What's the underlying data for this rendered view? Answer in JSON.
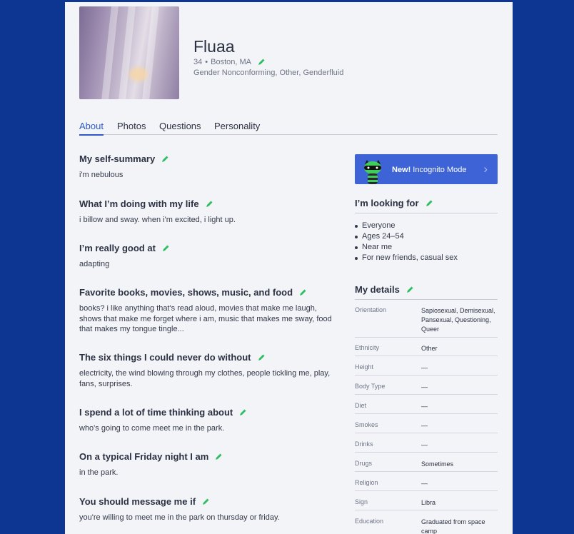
{
  "profile": {
    "name": "Fluaa",
    "age": "34",
    "separator": "•",
    "location": "Boston, MA",
    "identity": "Gender Nonconforming, Other, Genderfluid"
  },
  "tabs": [
    {
      "label": "About",
      "active": true
    },
    {
      "label": "Photos",
      "active": false
    },
    {
      "label": "Questions",
      "active": false
    },
    {
      "label": "Personality",
      "active": false
    }
  ],
  "essays": [
    {
      "title": "My self-summary",
      "text": "i'm nebulous"
    },
    {
      "title": "What I’m doing with my life",
      "text": "i billow and sway. when i'm excited, i light up."
    },
    {
      "title": "I’m really good at",
      "text": "adapting"
    },
    {
      "title": "Favorite books, movies, shows, music, and food",
      "text": "books? i like anything that's read aloud, movies that make me laugh, shows that make me forget where i am, music that makes me sway, food that makes my tongue tingle..."
    },
    {
      "title": "The six things I could never do without",
      "text": "electricity, the wind blowing through my clothes, people tickling me, play, fans, surprises."
    },
    {
      "title": "I spend a lot of time thinking about",
      "text": "who's going to come meet me in the park."
    },
    {
      "title": "On a typical Friday night I am",
      "text": "in the park."
    },
    {
      "title": "You should message me if",
      "text": "you're willing to meet me in the park on thursday or friday."
    }
  ],
  "incognito": {
    "new_label": "New!",
    "label": "Incognito Mode",
    "chevron": "›"
  },
  "looking_for": {
    "title": "I’m looking for",
    "items": [
      "Everyone",
      "Ages 24–54",
      "Near me",
      "For new friends, casual sex"
    ]
  },
  "details": {
    "title": "My details",
    "rows": [
      {
        "label": "Orientation",
        "value": "Sapiosexual, Demisexual, Pansexual, Questioning, Queer"
      },
      {
        "label": "Ethnicity",
        "value": "Other"
      },
      {
        "label": "Height",
        "value": "—"
      },
      {
        "label": "Body Type",
        "value": "—"
      },
      {
        "label": "Diet",
        "value": "—"
      },
      {
        "label": "Smokes",
        "value": "—"
      },
      {
        "label": "Drinks",
        "value": "—"
      },
      {
        "label": "Drugs",
        "value": "Sometimes"
      },
      {
        "label": "Religion",
        "value": "—"
      },
      {
        "label": "Sign",
        "value": "Libra"
      },
      {
        "label": "Education",
        "value": "Graduated from space camp"
      }
    ]
  },
  "colors": {
    "page_bg": "#0d3592",
    "accent": "#2d5ac4",
    "incognito_bg": "#3d63d6",
    "edit_icon": "#2bbf62"
  },
  "icons": {
    "edit": "pencil-icon",
    "incognito": "raccoon-mascot-icon",
    "next": "chevron-right-icon"
  }
}
